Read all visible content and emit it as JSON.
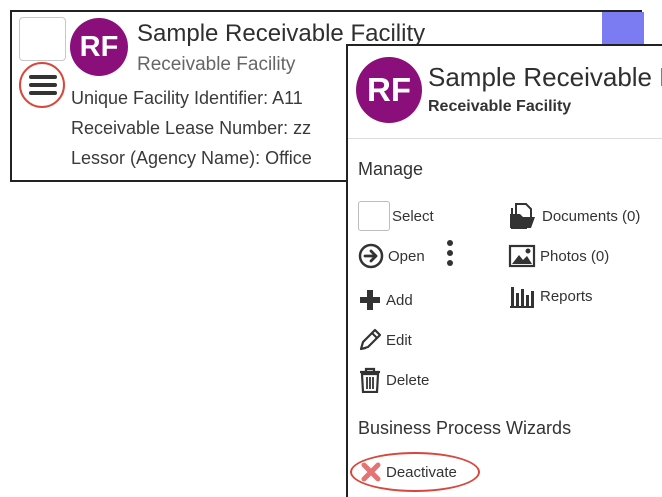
{
  "card": {
    "avatar_initials": "RF",
    "title": "Sample Receivable Facility",
    "subtitle": "Receivable Facility",
    "lines": [
      "Unique Facility Identifier: A11",
      "Receivable Lease Number: zz",
      "Lessor (Agency Name): Office"
    ],
    "accent_color": "#7b7bf2"
  },
  "popup": {
    "avatar_initials": "RF",
    "title": "Sample Receivable Fac",
    "subtitle": "Receivable Facility",
    "manage_heading": "Manage",
    "items": {
      "select": "Select",
      "open": "Open",
      "add": "Add",
      "edit": "Edit",
      "delete": "Delete",
      "documents": "Documents (0)",
      "photos": "Photos (0)",
      "reports": "Reports"
    },
    "wizards_heading": "Business Process Wizards",
    "deactivate": "Deactivate"
  },
  "colors": {
    "avatar": "#8b0f7a",
    "highlight_ring": "#d9463c",
    "deactivate_icon": "#e57373"
  },
  "icons": {
    "menu": "hamburger-icon",
    "open": "arrow-circle-right-icon",
    "more": "kebab-icon",
    "add": "plus-icon",
    "edit": "pencil-icon",
    "delete": "trash-icon",
    "documents": "documents-icon",
    "photos": "photo-icon",
    "reports": "bar-chart-icon",
    "deactivate": "x-icon"
  }
}
